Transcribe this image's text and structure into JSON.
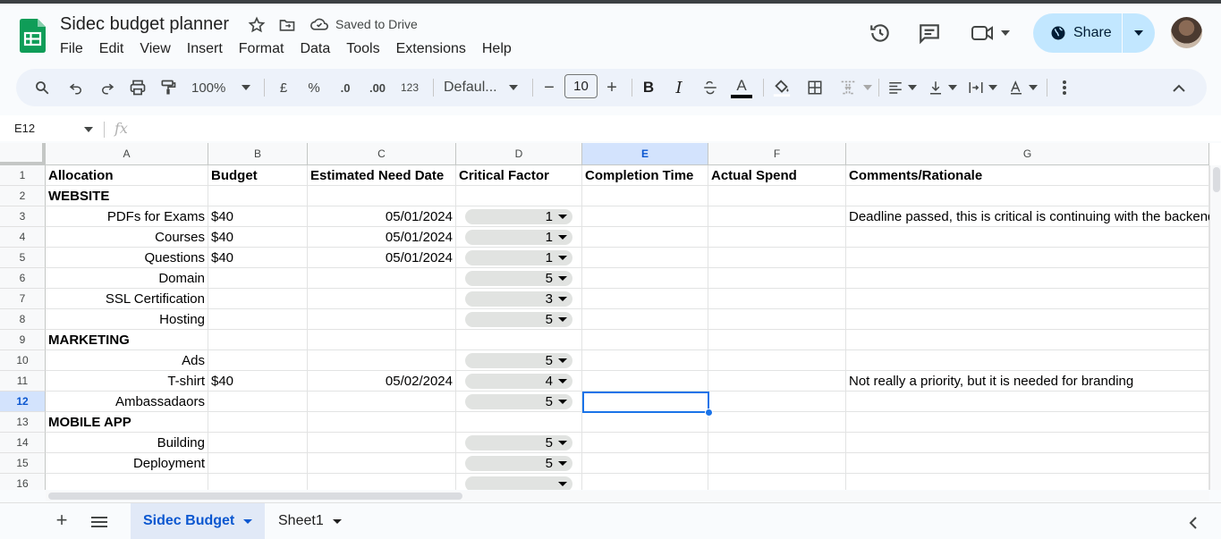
{
  "app": {
    "doc_title": "Sidec budget planner",
    "saved_status": "Saved to Drive",
    "menu": [
      "File",
      "Edit",
      "View",
      "Insert",
      "Format",
      "Data",
      "Tools",
      "Extensions",
      "Help"
    ],
    "share_label": "Share"
  },
  "toolbar": {
    "zoom": "100%",
    "currency": "£",
    "percent": "%",
    "dec_decrease": ".0",
    "dec_increase": ".00",
    "number_format": "123",
    "font": "Defaul...",
    "font_size": "10",
    "bold": "B",
    "italic": "I",
    "text_color": "A"
  },
  "formula_bar": {
    "name_box": "E12",
    "fx": "fx",
    "content": ""
  },
  "columns": [
    "A",
    "B",
    "C",
    "D",
    "E",
    "F",
    "G"
  ],
  "selected": {
    "column": "E",
    "row": "12"
  },
  "rows": [
    {
      "n": "1",
      "a": "Allocation",
      "b": "Budget",
      "c": "Estimated Need Date",
      "d": "Critical Factor",
      "e": "Completion Time",
      "f": "Actual Spend",
      "g": "Comments/Rationale"
    },
    {
      "n": "2",
      "a": "WEBSITE",
      "b": "",
      "c": "",
      "d": "",
      "e": "",
      "f": "",
      "g": ""
    },
    {
      "n": "3",
      "a": "PDFs for Exams",
      "b": "$40",
      "c": "05/01/2024",
      "d": "1",
      "e": "",
      "f": "",
      "g": "Deadline passed, this is critical is continuing with the backend"
    },
    {
      "n": "4",
      "a": "Courses",
      "b": "$40",
      "c": "05/01/2024",
      "d": "1",
      "e": "",
      "f": "",
      "g": ""
    },
    {
      "n": "5",
      "a": "Questions",
      "b": "$40",
      "c": "05/01/2024",
      "d": "1",
      "e": "",
      "f": "",
      "g": ""
    },
    {
      "n": "6",
      "a": "Domain",
      "b": "",
      "c": "",
      "d": "5",
      "e": "",
      "f": "",
      "g": ""
    },
    {
      "n": "7",
      "a": "SSL Certification",
      "b": "",
      "c": "",
      "d": "3",
      "e": "",
      "f": "",
      "g": ""
    },
    {
      "n": "8",
      "a": "Hosting",
      "b": "",
      "c": "",
      "d": "5",
      "e": "",
      "f": "",
      "g": ""
    },
    {
      "n": "9",
      "a": "MARKETING",
      "b": "",
      "c": "",
      "d": "",
      "e": "",
      "f": "",
      "g": ""
    },
    {
      "n": "10",
      "a": "Ads",
      "b": "",
      "c": "",
      "d": "5",
      "e": "",
      "f": "",
      "g": ""
    },
    {
      "n": "11",
      "a": "T-shirt",
      "b": "$40",
      "c": "05/02/2024",
      "d": "4",
      "e": "",
      "f": "",
      "g": "Not really a priority, but it is needed for branding"
    },
    {
      "n": "12",
      "a": "Ambassadaors",
      "b": "",
      "c": "",
      "d": "5",
      "e": "",
      "f": "",
      "g": ""
    },
    {
      "n": "13",
      "a": "MOBILE APP",
      "b": "",
      "c": "",
      "d": "",
      "e": "",
      "f": "",
      "g": ""
    },
    {
      "n": "14",
      "a": "Building",
      "b": "",
      "c": "",
      "d": "5",
      "e": "",
      "f": "",
      "g": ""
    },
    {
      "n": "15",
      "a": "Deployment",
      "b": "",
      "c": "",
      "d": "5",
      "e": "",
      "f": "",
      "g": ""
    },
    {
      "n": "16",
      "a": "",
      "b": "",
      "c": "",
      "d": "",
      "e": "",
      "f": "",
      "g": ""
    }
  ],
  "sheets": [
    {
      "name": "Sidec Budget",
      "active": true
    },
    {
      "name": "Sheet1",
      "active": false
    }
  ],
  "colors": {
    "accent": "#1a73e8",
    "share_bg": "#c2e7ff",
    "sheets_green": "#0f9d58"
  }
}
